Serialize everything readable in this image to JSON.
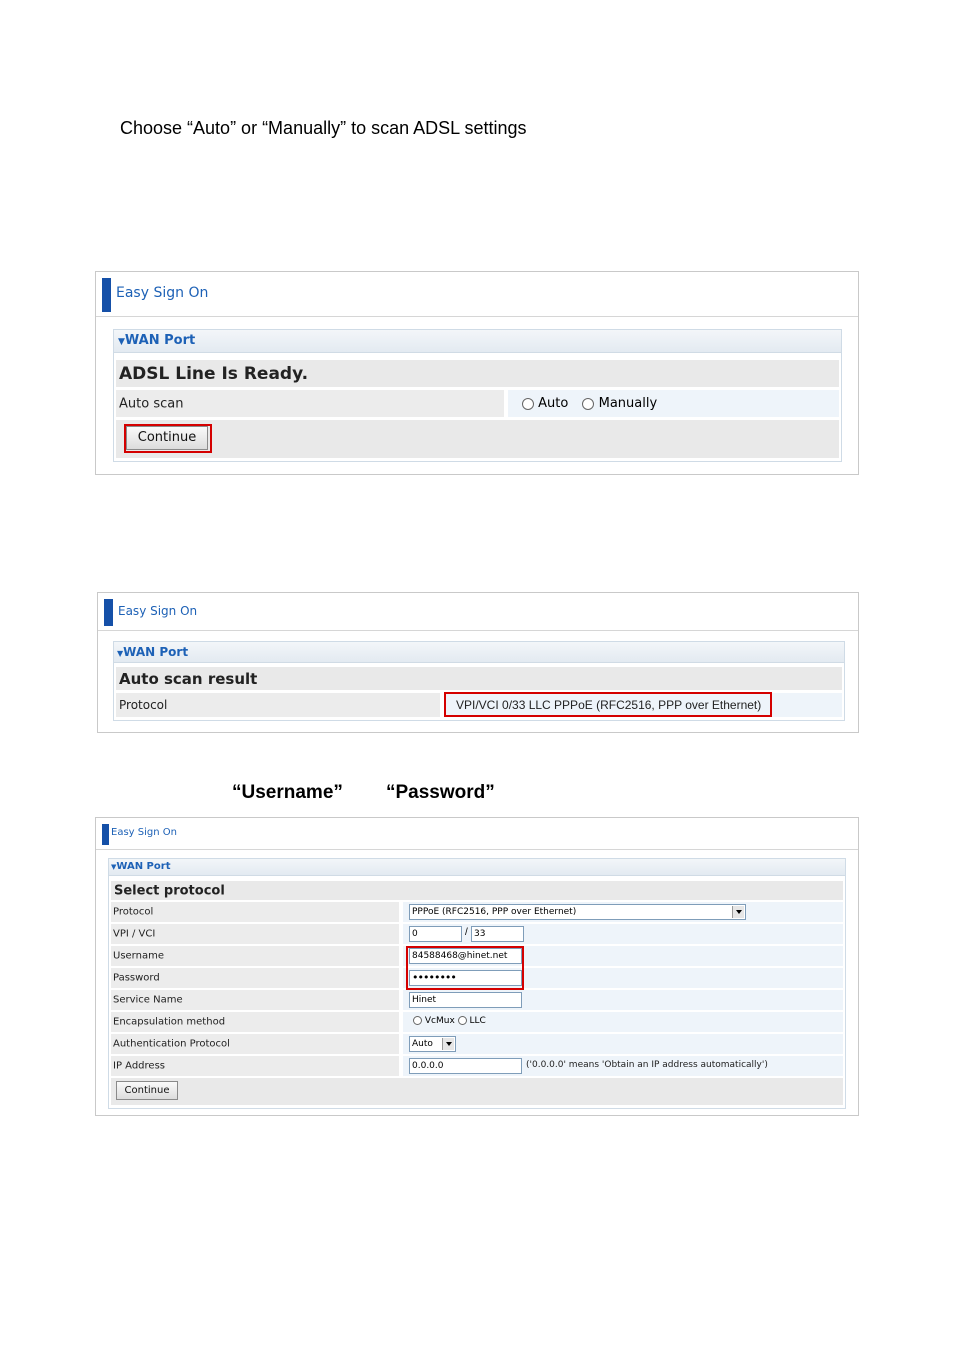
{
  "intro": "Choose “Auto” or “Manually” to scan ADSL settings",
  "captions": {
    "username": "“Username”",
    "password": "“Password”"
  },
  "panel1": {
    "title": "Easy Sign On",
    "section": "WAN Port",
    "status": "ADSL Line Is Ready.",
    "auto_scan_label": "Auto scan",
    "options": [
      "Auto",
      "Manually"
    ],
    "selected": "Auto",
    "continue": "Continue"
  },
  "panel2": {
    "title": "Easy Sign On",
    "section": "WAN Port",
    "heading": "Auto scan result",
    "protocol_label": "Protocol",
    "protocol_value": "VPI/VCI 0/33 LLC PPPoE (RFC2516, PPP over Ethernet)"
  },
  "panel3": {
    "title": "Easy Sign On",
    "section": "WAN Port",
    "heading": "Select protocol",
    "labels": {
      "protocol": "Protocol",
      "vpivci": "VPI / VCI",
      "username": "Username",
      "password": "Password",
      "service": "Service Name",
      "encap": "Encapsulation method",
      "auth": "Authentication Protocol",
      "ip": "IP Address"
    },
    "protocol_value": "PPPoE (RFC2516, PPP over Ethernet)",
    "vpi": "0",
    "vci_sep": "/",
    "vci": "33",
    "username": "84588468@hinet.net",
    "password": "••••••••",
    "service": "Hinet",
    "encap_options": [
      "VcMux",
      "LLC"
    ],
    "encap_selected": "LLC",
    "auth": "Auto",
    "ip": "0.0.0.0",
    "ip_note": "('0.0.0.0' means 'Obtain an IP address automatically')",
    "continue": "Continue"
  },
  "colors": {
    "accent": "#1d61b6",
    "highlight": "#d40000"
  }
}
